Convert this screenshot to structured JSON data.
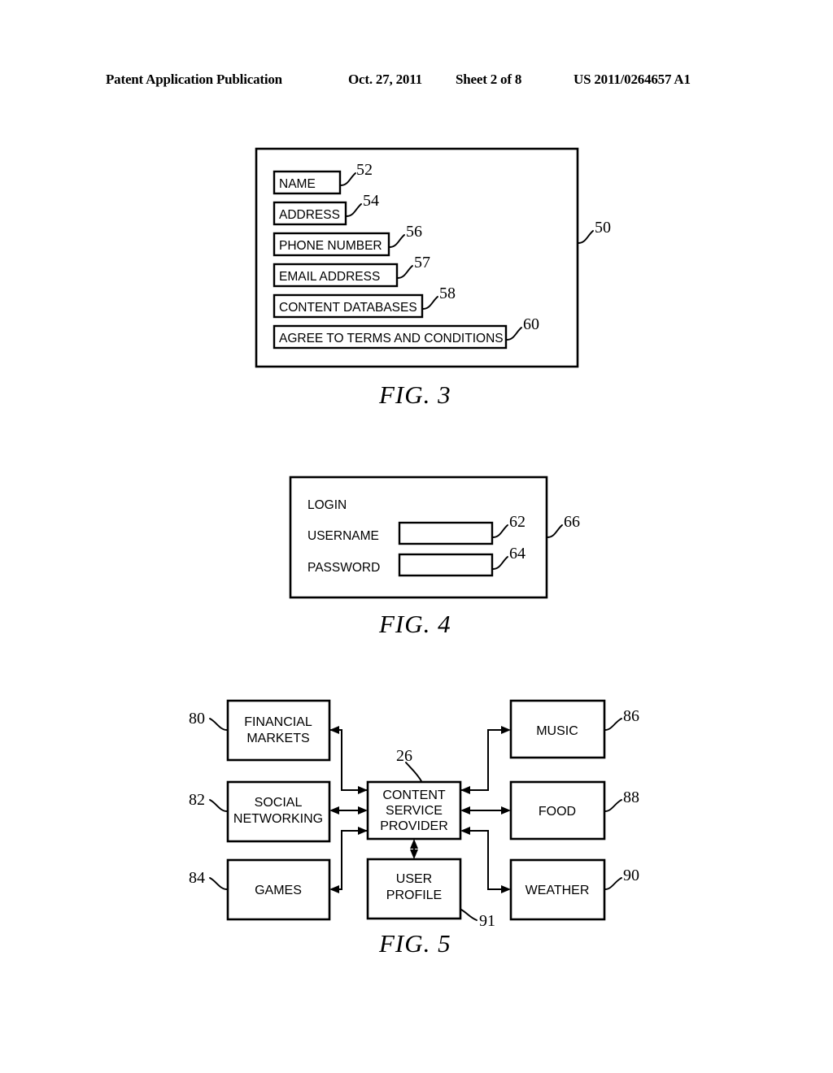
{
  "header": {
    "publication": "Patent Application Publication",
    "date": "Oct. 27, 2011",
    "sheet": "Sheet 2 of 8",
    "patent_number": "US 2011/0264657 A1"
  },
  "figures": [
    {
      "caption": "FIG. 3",
      "container_ref": "50",
      "fields": [
        {
          "label": "NAME",
          "ref": "52"
        },
        {
          "label": "ADDRESS",
          "ref": "54"
        },
        {
          "label": "PHONE NUMBER",
          "ref": "56"
        },
        {
          "label": "EMAIL ADDRESS",
          "ref": "57"
        },
        {
          "label": "CONTENT DATABASES",
          "ref": "58"
        },
        {
          "label": "AGREE TO TERMS AND CONDITIONS",
          "ref": "60"
        }
      ]
    },
    {
      "caption": "FIG. 4",
      "container_ref": "66",
      "title": "LOGIN",
      "fields": [
        {
          "label": "USERNAME",
          "ref": "62",
          "value": ""
        },
        {
          "label": "PASSWORD",
          "ref": "64",
          "value": ""
        }
      ]
    },
    {
      "caption": "FIG. 5",
      "nodes": [
        {
          "id": "financial_markets",
          "lines": [
            "FINANCIAL",
            "MARKETS"
          ],
          "ref": "80"
        },
        {
          "id": "social_networking",
          "lines": [
            "SOCIAL",
            "NETWORKING"
          ],
          "ref": "82"
        },
        {
          "id": "games",
          "lines": [
            "GAMES"
          ],
          "ref": "84"
        },
        {
          "id": "content_service",
          "lines": [
            "CONTENT",
            "SERVICE",
            "PROVIDER"
          ],
          "ref": "26"
        },
        {
          "id": "user_profile",
          "lines": [
            "USER",
            "PROFILE"
          ],
          "ref": "91"
        },
        {
          "id": "music",
          "lines": [
            "MUSIC"
          ],
          "ref": "86"
        },
        {
          "id": "food",
          "lines": [
            "FOOD"
          ],
          "ref": "88"
        },
        {
          "id": "weather",
          "lines": [
            "WEATHER"
          ],
          "ref": "90"
        }
      ],
      "connections": [
        {
          "from": "content_service",
          "to": "financial_markets",
          "direction": "one-way"
        },
        {
          "from": "content_service",
          "to": "social_networking",
          "direction": "two-way"
        },
        {
          "from": "content_service",
          "to": "games",
          "direction": "one-way"
        },
        {
          "from": "music",
          "to": "content_service",
          "direction": "one-way"
        },
        {
          "from": "content_service",
          "to": "food",
          "direction": "two-way"
        },
        {
          "from": "content_service",
          "to": "weather",
          "direction": "one-way"
        },
        {
          "from": "content_service",
          "to": "user_profile",
          "direction": "two-way"
        }
      ]
    }
  ],
  "colors": {
    "ink": "#000000",
    "paper": "#ffffff"
  }
}
